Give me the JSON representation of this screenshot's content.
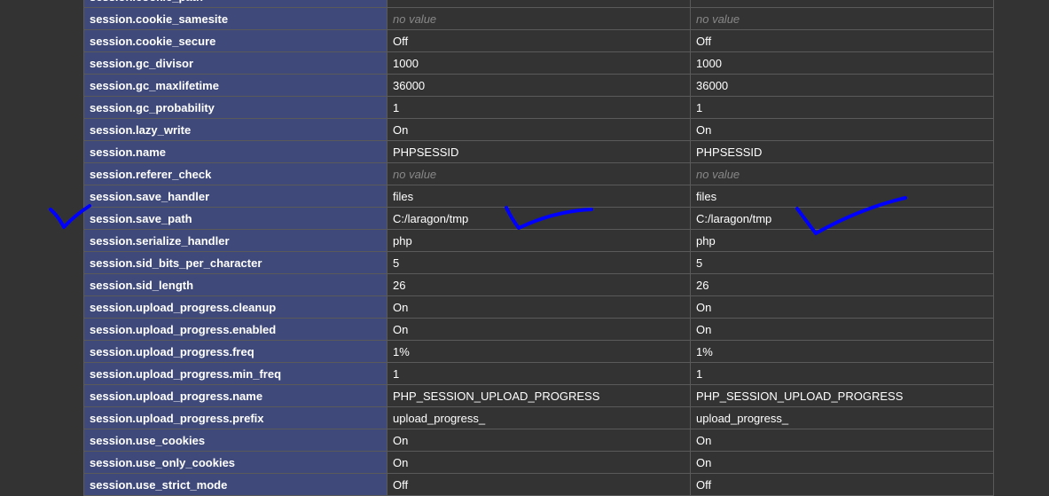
{
  "table": {
    "rows": [
      {
        "directive": "session.cookie_path",
        "local": "",
        "master": "",
        "no_value": false
      },
      {
        "directive": "session.cookie_samesite",
        "local": "no value",
        "master": "no value",
        "no_value": true
      },
      {
        "directive": "session.cookie_secure",
        "local": "Off",
        "master": "Off",
        "no_value": false
      },
      {
        "directive": "session.gc_divisor",
        "local": "1000",
        "master": "1000",
        "no_value": false
      },
      {
        "directive": "session.gc_maxlifetime",
        "local": "36000",
        "master": "36000",
        "no_value": false
      },
      {
        "directive": "session.gc_probability",
        "local": "1",
        "master": "1",
        "no_value": false
      },
      {
        "directive": "session.lazy_write",
        "local": "On",
        "master": "On",
        "no_value": false
      },
      {
        "directive": "session.name",
        "local": "PHPSESSID",
        "master": "PHPSESSID",
        "no_value": false
      },
      {
        "directive": "session.referer_check",
        "local": "no value",
        "master": "no value",
        "no_value": true
      },
      {
        "directive": "session.save_handler",
        "local": "files",
        "master": "files",
        "no_value": false
      },
      {
        "directive": "session.save_path",
        "local": "C:/laragon/tmp",
        "master": "C:/laragon/tmp",
        "no_value": false
      },
      {
        "directive": "session.serialize_handler",
        "local": "php",
        "master": "php",
        "no_value": false
      },
      {
        "directive": "session.sid_bits_per_character",
        "local": "5",
        "master": "5",
        "no_value": false
      },
      {
        "directive": "session.sid_length",
        "local": "26",
        "master": "26",
        "no_value": false
      },
      {
        "directive": "session.upload_progress.cleanup",
        "local": "On",
        "master": "On",
        "no_value": false
      },
      {
        "directive": "session.upload_progress.enabled",
        "local": "On",
        "master": "On",
        "no_value": false
      },
      {
        "directive": "session.upload_progress.freq",
        "local": "1%",
        "master": "1%",
        "no_value": false
      },
      {
        "directive": "session.upload_progress.min_freq",
        "local": "1",
        "master": "1",
        "no_value": false
      },
      {
        "directive": "session.upload_progress.name",
        "local": "PHP_SESSION_UPLOAD_PROGRESS",
        "master": "PHP_SESSION_UPLOAD_PROGRESS",
        "no_value": false
      },
      {
        "directive": "session.upload_progress.prefix",
        "local": "upload_progress_",
        "master": "upload_progress_",
        "no_value": false
      },
      {
        "directive": "session.use_cookies",
        "local": "On",
        "master": "On",
        "no_value": false
      },
      {
        "directive": "session.use_only_cookies",
        "local": "On",
        "master": "On",
        "no_value": false
      },
      {
        "directive": "session.use_strict_mode",
        "local": "Off",
        "master": "Off",
        "no_value": false
      }
    ]
  },
  "annotations": {
    "color": "#0000ff",
    "checkmarks": [
      "directive-checkmark",
      "local-value-checkmark",
      "master-value-checkmark"
    ]
  },
  "colors": {
    "background": "#333333",
    "directive_cell": "#3f4a7a",
    "no_value_text": "#888888"
  }
}
